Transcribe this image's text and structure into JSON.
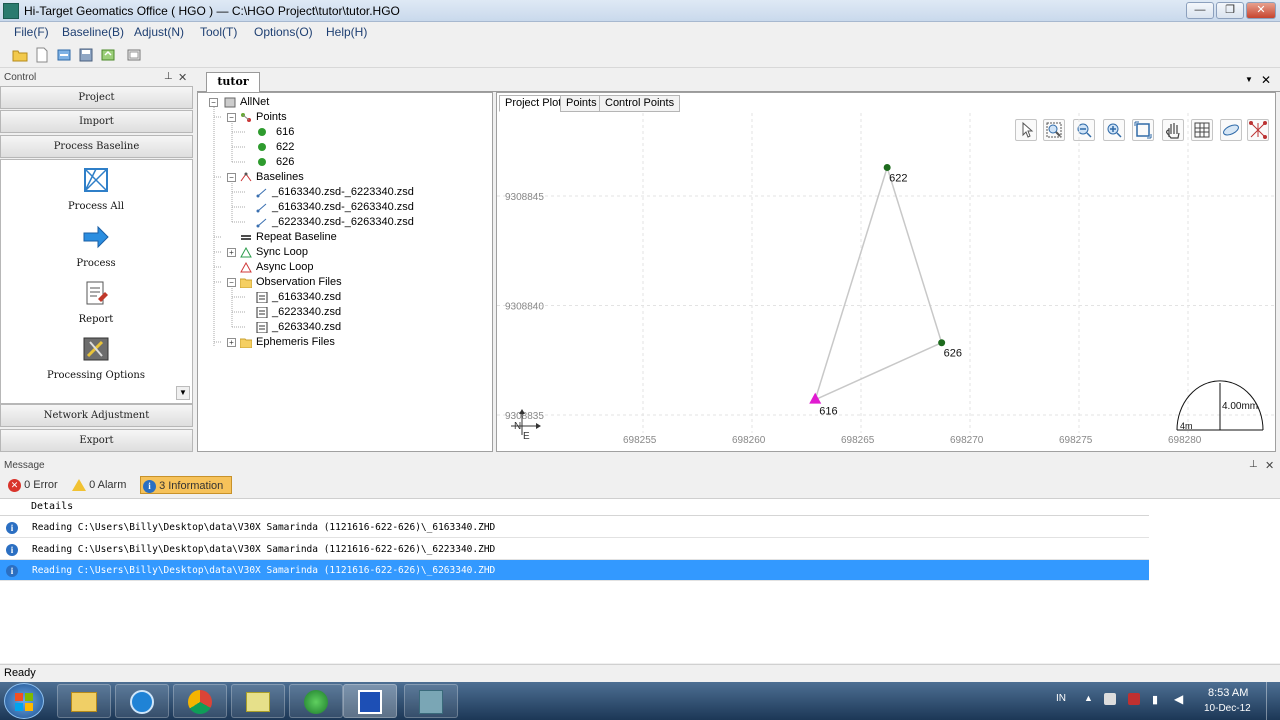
{
  "window": {
    "title": "Hi-Target Geomatics Office ( HGO ) — C:\\HGO Project\\tutor\\tutor.HGO",
    "min_glyph": "—",
    "max_glyph": "❐",
    "close_glyph": "✕"
  },
  "menu": [
    "File(F)",
    "Baseline(B)",
    "Adjust(N)",
    "Tool(T)",
    "Options(O)",
    "Help(H)"
  ],
  "control": {
    "title": "Control",
    "pin_glyph": "⊥",
    "close_glyph": "✕",
    "sections": {
      "project": "Project",
      "import": "Import",
      "process_baseline": "Process Baseline",
      "network_adjustment": "Network Adjustment",
      "export": "Export"
    },
    "items": [
      {
        "label": "Process All",
        "icon": "process-all-icon"
      },
      {
        "label": "Process",
        "icon": "arrow-right-icon"
      },
      {
        "label": "Report",
        "icon": "report-icon"
      },
      {
        "label": "Processing Options",
        "icon": "processing-options-icon"
      }
    ]
  },
  "doc": {
    "tab": "tutor",
    "menu_glyph": "▼",
    "close_glyph": "✕"
  },
  "tree": {
    "root": "AllNet",
    "points_label": "Points",
    "points": [
      "616",
      "622",
      "626"
    ],
    "baselines_label": "Baselines",
    "baselines": [
      "_6163340.zsd-_6223340.zsd",
      "_6163340.zsd-_6263340.zsd",
      "_6223340.zsd-_6263340.zsd"
    ],
    "repeat_baseline": "Repeat Baseline",
    "sync_loop": "Sync Loop",
    "async_loop": "Async Loop",
    "observation_files_label": "Observation Files",
    "observation_files": [
      "_6163340.zsd",
      "_6223340.zsd",
      "_6263340.zsd"
    ],
    "ephemeris_files": "Ephemeris Files"
  },
  "plot": {
    "tabs": [
      "Project Plot",
      "Points",
      "Control Points"
    ],
    "active_tab": "Project Plot",
    "tools": [
      "pointer-icon",
      "zoom-window-icon",
      "zoom-out-icon",
      "zoom-in-icon",
      "zoom-extent-icon",
      "pan-hand-icon",
      "grid-icon",
      "ellipse-icon",
      "network-icon"
    ],
    "y_ticks": [
      "9308845",
      "9308840",
      "9308835"
    ],
    "x_ticks": [
      "698255",
      "698260",
      "698265",
      "698270",
      "698275",
      "698280"
    ],
    "points": [
      {
        "name": "622",
        "e": 698266.2,
        "n": 9308846.3,
        "marker": "circle",
        "color": "#1d6b1d"
      },
      {
        "name": "626",
        "e": 698268.7,
        "n": 9308838.3,
        "marker": "circle",
        "color": "#1d6b1d"
      },
      {
        "name": "616",
        "e": 698262.9,
        "n": 9308835.7,
        "marker": "triangle",
        "color": "#e01ad0"
      }
    ],
    "baselines": [
      [
        "616",
        "622"
      ],
      [
        "616",
        "626"
      ],
      [
        "622",
        "626"
      ]
    ],
    "north_label": "N",
    "east_label": "E",
    "scale_vertical": "4.00mm",
    "scale_horizontal": "4m"
  },
  "message": {
    "title": "Message",
    "pin_glyph": "⊥",
    "close_glyph": "✕",
    "error": "0 Error",
    "alarm": "0 Alarm",
    "information": "3 Information",
    "column": "Details",
    "rows": [
      "Reading  C:\\Users\\Billy\\Desktop\\data\\V30X Samarinda (1121616-622-626)\\_6163340.ZHD",
      "Reading  C:\\Users\\Billy\\Desktop\\data\\V30X Samarinda (1121616-622-626)\\_6223340.ZHD",
      "Reading  C:\\Users\\Billy\\Desktop\\data\\V30X Samarinda (1121616-622-626)\\_6263340.ZHD"
    ],
    "selected_row": 2
  },
  "status": "Ready",
  "taskbar": {
    "lang": "IN",
    "time": "8:53 AM",
    "date": "10-Dec-12",
    "apps": [
      "file-explorer-icon",
      "itunes-icon",
      "chrome-icon",
      "folder-icon",
      "globe-icon",
      "hgo-app-icon",
      "gnss-app-icon"
    ]
  },
  "colors": {
    "selection": "#3399ff",
    "point_green": "#1d6b1d",
    "point_known": "#e01ad0",
    "info_filter_bg": "#f6c25a"
  }
}
